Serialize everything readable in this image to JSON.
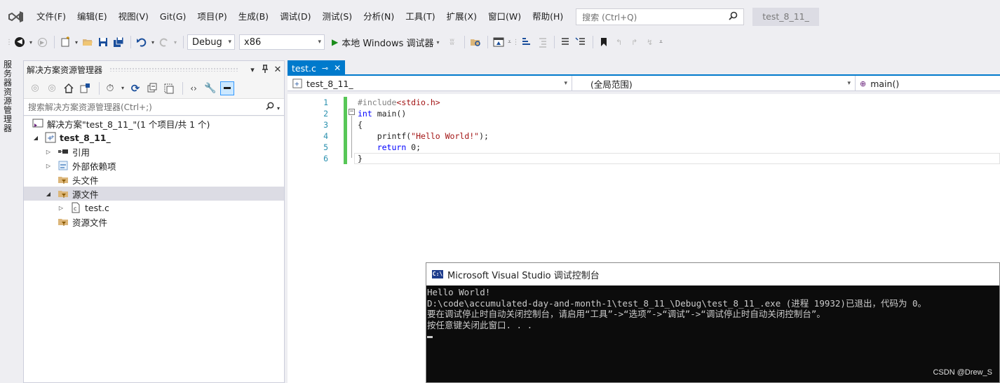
{
  "menu": {
    "items": [
      "文件(F)",
      "编辑(E)",
      "视图(V)",
      "Git(G)",
      "项目(P)",
      "生成(B)",
      "调试(D)",
      "测试(S)",
      "分析(N)",
      "工具(T)",
      "扩展(X)",
      "窗口(W)",
      "帮助(H)"
    ],
    "search_placeholder": "搜索 (Ctrl+Q)",
    "solution_title": "test_8_11_"
  },
  "toolbar": {
    "config": "Debug",
    "platform": "x86",
    "run_label": "本地 Windows 调试器"
  },
  "side_tab": "服务器资源管理器",
  "solution_explorer": {
    "title": "解决方案资源管理器",
    "search_placeholder": "搜索解决方案资源管理器(Ctrl+;)",
    "tree": {
      "solution": "解决方案\"test_8_11_\"(1 个项目/共 1 个)",
      "project": "test_8_11_",
      "references": "引用",
      "external": "外部依赖项",
      "headers": "头文件",
      "sources": "源文件",
      "source_file": "test.c",
      "resources": "资源文件"
    }
  },
  "editor": {
    "tab_label": "test.c",
    "nav_project": "test_8_11_",
    "nav_scope": "(全局范围)",
    "nav_member": "main()",
    "lines": [
      {
        "n": "1",
        "indent": "",
        "parts": [
          [
            "pp",
            "#include"
          ],
          [
            "str",
            "<stdio.h>"
          ]
        ]
      },
      {
        "n": "2",
        "indent": "",
        "parts": [
          [
            "kw",
            "int"
          ],
          [
            "fn",
            " main()"
          ]
        ]
      },
      {
        "n": "3",
        "indent": "",
        "parts": [
          [
            "fn",
            "{"
          ]
        ]
      },
      {
        "n": "4",
        "indent": "    ",
        "parts": [
          [
            "fn",
            "printf("
          ],
          [
            "str",
            "\"Hello World!\""
          ],
          [
            "fn",
            ");"
          ]
        ]
      },
      {
        "n": "5",
        "indent": "    ",
        "parts": [
          [
            "kw",
            "return"
          ],
          [
            "fn",
            " 0;"
          ]
        ]
      },
      {
        "n": "6",
        "indent": "",
        "parts": [
          [
            "fn",
            "}"
          ]
        ]
      }
    ]
  },
  "console": {
    "title": "Microsoft Visual Studio 调试控制台",
    "lines": [
      "Hello World!",
      "D:\\code\\accumulated-day-and-month-1\\test_8_11_\\Debug\\test_8_11_.exe (进程 19932)已退出，代码为 0。",
      "要在调试停止时自动关闭控制台，请启用“工具”->“选项”->“调试”->“调试停止时自动关闭控制台”。",
      "按任意键关闭此窗口. . ."
    ],
    "watermark": "CSDN @Drew_S"
  }
}
